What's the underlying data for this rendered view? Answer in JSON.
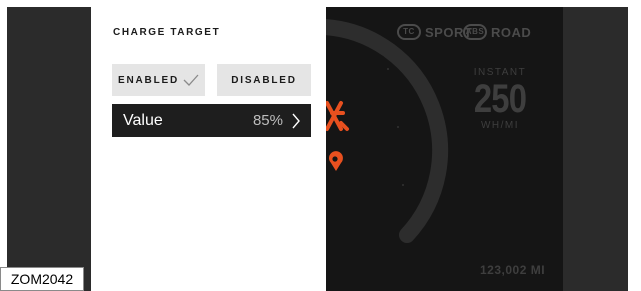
{
  "panel": {
    "title": "CHARGE TARGET",
    "enabled_label": "ENABLED",
    "disabled_label": "DISABLED",
    "selected": "enabled",
    "value_label": "Value",
    "value": "85%"
  },
  "dashboard": {
    "mode_tc": "TC",
    "mode_sport": "SPORT",
    "mode_abs": "ABS",
    "mode_road": "ROAD",
    "instant_label": "INSTANT",
    "instant_value": "250",
    "instant_unit": "WH/MI",
    "odometer": "123,002 MI"
  },
  "caption": "ZOM2042",
  "colors": {
    "accent": "#e8501f",
    "panel_bg": "#ffffff",
    "screen_bg": "#151515",
    "dim_text": "#3e3e3e"
  }
}
